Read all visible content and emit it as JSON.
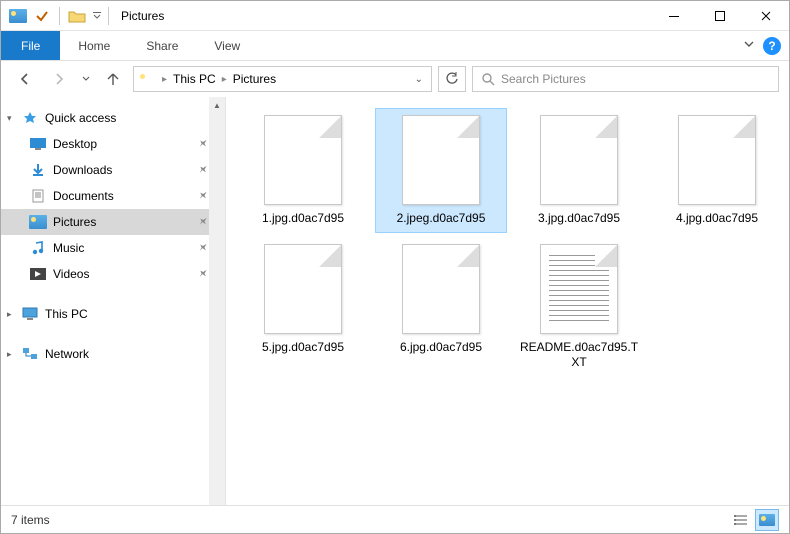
{
  "titlebar": {
    "title": "Pictures"
  },
  "ribbon": {
    "file": "File",
    "tabs": [
      "Home",
      "Share",
      "View"
    ]
  },
  "nav": {
    "breadcrumb": [
      "This PC",
      "Pictures"
    ],
    "search_placeholder": "Search Pictures"
  },
  "sidebar": {
    "quick": {
      "header": "Quick access",
      "items": [
        {
          "label": "Desktop",
          "icon": "desktop"
        },
        {
          "label": "Downloads",
          "icon": "downloads"
        },
        {
          "label": "Documents",
          "icon": "documents"
        },
        {
          "label": "Pictures",
          "icon": "pictures",
          "active": true
        },
        {
          "label": "Music",
          "icon": "music"
        },
        {
          "label": "Videos",
          "icon": "videos"
        }
      ]
    },
    "thispc": "This PC",
    "network": "Network"
  },
  "files": [
    {
      "name": "1.jpg.d0ac7d95",
      "type": "blank"
    },
    {
      "name": "2.jpeg.d0ac7d95",
      "type": "blank",
      "selected": true
    },
    {
      "name": "3.jpg.d0ac7d95",
      "type": "blank"
    },
    {
      "name": "4.jpg.d0ac7d95",
      "type": "blank"
    },
    {
      "name": "5.jpg.d0ac7d95",
      "type": "blank"
    },
    {
      "name": "6.jpg.d0ac7d95",
      "type": "blank"
    },
    {
      "name": "README.d0ac7d95.TXT",
      "type": "text"
    }
  ],
  "status": {
    "count_label": "7 items"
  }
}
